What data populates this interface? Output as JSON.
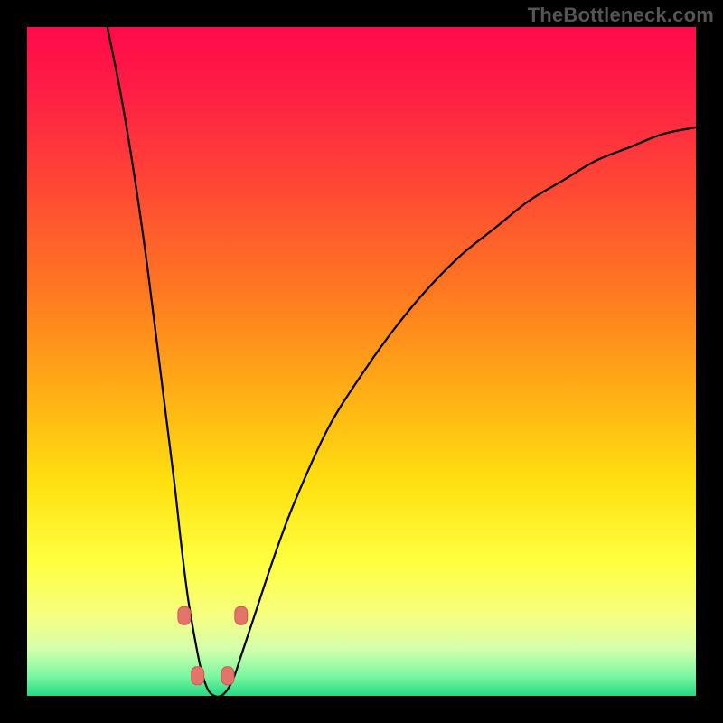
{
  "watermark": "TheBottleneck.com",
  "colors": {
    "gradient_stops": [
      {
        "offset": 0.0,
        "color": "#ff0a4a"
      },
      {
        "offset": 0.1,
        "color": "#ff1f45"
      },
      {
        "offset": 0.25,
        "color": "#ff4b33"
      },
      {
        "offset": 0.4,
        "color": "#ff7a20"
      },
      {
        "offset": 0.55,
        "color": "#ffb015"
      },
      {
        "offset": 0.68,
        "color": "#ffe010"
      },
      {
        "offset": 0.8,
        "color": "#ffff40"
      },
      {
        "offset": 0.88,
        "color": "#f6ff80"
      },
      {
        "offset": 0.93,
        "color": "#d4ffad"
      },
      {
        "offset": 0.97,
        "color": "#7cf7a0"
      },
      {
        "offset": 1.0,
        "color": "#25d985"
      }
    ],
    "curve_stroke": "#000000",
    "marker_fill": "#e4736a",
    "marker_stroke": "#c95a52"
  },
  "chart_data": {
    "type": "line",
    "title": "",
    "xlabel": "",
    "ylabel": "",
    "xlim": [
      0,
      100
    ],
    "ylim": [
      0,
      100
    ],
    "grid": false,
    "legend": false,
    "note": "Axes inferred as 0–100 percent scales (bottleneck %). Curve minimum ≈ 0% near x ≈ 26–30; right branch reaches ≈ 85% at x = 100; left branch exits top at x ≈ 12. Values estimated from pixels.",
    "series": [
      {
        "name": "bottleneck-curve",
        "x": [
          12,
          14,
          16,
          18,
          20,
          22,
          23,
          24,
          25,
          26,
          27,
          28,
          29,
          30,
          31,
          32,
          34,
          37,
          40,
          45,
          50,
          55,
          60,
          65,
          70,
          75,
          80,
          85,
          90,
          95,
          100
        ],
        "y": [
          100,
          90,
          78,
          64,
          48,
          32,
          23,
          15,
          9,
          4,
          1,
          0,
          0,
          1,
          3,
          6,
          12,
          21,
          29,
          40,
          48,
          55,
          61,
          66,
          70,
          74,
          77,
          80,
          82,
          84,
          85
        ]
      }
    ],
    "markers": {
      "name": "threshold-markers",
      "points": [
        {
          "x": 23.5,
          "y": 12
        },
        {
          "x": 32.0,
          "y": 12
        },
        {
          "x": 25.5,
          "y": 3
        },
        {
          "x": 30.0,
          "y": 3
        }
      ]
    }
  }
}
